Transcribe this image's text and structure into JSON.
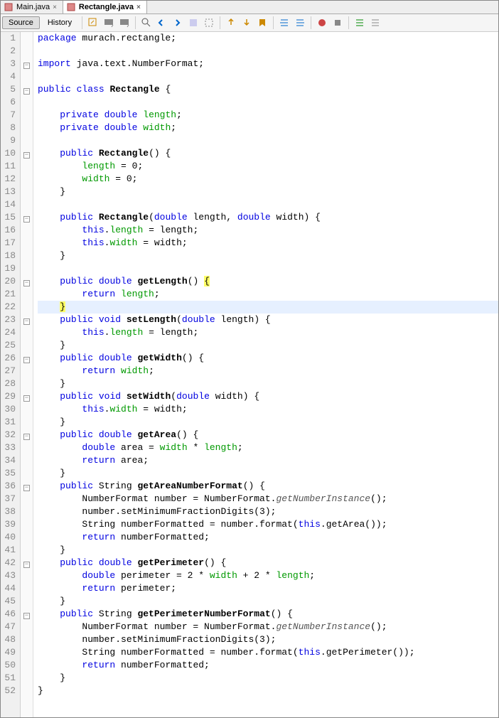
{
  "tabs": [
    {
      "label": "Main.java",
      "active": false
    },
    {
      "label": "Rectangle.java",
      "active": true
    }
  ],
  "viewButtons": {
    "source": "Source",
    "history": "History"
  },
  "gutter": [
    "1",
    "2",
    "3",
    "4",
    "5",
    "6",
    "7",
    "8",
    "9",
    "10",
    "11",
    "12",
    "13",
    "14",
    "15",
    "16",
    "17",
    "18",
    "19",
    "20",
    "21",
    "22",
    "23",
    "24",
    "25",
    "26",
    "27",
    "28",
    "29",
    "30",
    "31",
    "32",
    "33",
    "34",
    "35",
    "36",
    "37",
    "38",
    "39",
    "40",
    "41",
    "42",
    "43",
    "44",
    "45",
    "46",
    "47",
    "48",
    "49",
    "50",
    "51",
    "52"
  ],
  "code": {
    "l1": {
      "w1": "package",
      "w2": " murach.rectangle;"
    },
    "l3": {
      "w1": "import",
      "w2": " java.text.NumberFormat;"
    },
    "l5": {
      "w1": "public",
      "w2": "class",
      "w3": "Rectangle",
      "w4": " {"
    },
    "l7": {
      "w1": "private",
      "w2": "double",
      "w3": "length",
      "w4": ";"
    },
    "l8": {
      "w1": "private",
      "w2": "double",
      "w3": "width",
      "w4": ";"
    },
    "l10": {
      "w1": "public",
      "w2": "Rectangle",
      "w3": "() {"
    },
    "l11": {
      "w1": "length",
      "w2": " = 0;"
    },
    "l12": {
      "w1": "width",
      "w2": " = 0;"
    },
    "l13": "    }",
    "l15": {
      "w1": "public",
      "w2": "Rectangle",
      "w3": "(",
      "w4": "double",
      "w5": " length, ",
      "w6": "double",
      "w7": " width) {"
    },
    "l16": {
      "w1": "this",
      "w2": ".",
      "w3": "length",
      "w4": " = length;"
    },
    "l17": {
      "w1": "this",
      "w2": ".",
      "w3": "width",
      "w4": " = width;"
    },
    "l18": "    }",
    "l20": {
      "w1": "public",
      "w2": "double",
      "w3": "getLength",
      "w4": "() ",
      "w5": "{"
    },
    "l21": {
      "w1": "return",
      "w2": "length",
      "w3": ";"
    },
    "l22": "}",
    "l23": {
      "w1": "public",
      "w2": "void",
      "w3": "setLength",
      "w4": "(",
      "w5": "double",
      "w6": " length) {"
    },
    "l24": {
      "w1": "this",
      "w2": ".",
      "w3": "length",
      "w4": " = length;"
    },
    "l25": "    }",
    "l26": {
      "w1": "public",
      "w2": "double",
      "w3": "getWidth",
      "w4": "() {"
    },
    "l27": {
      "w1": "return",
      "w2": "width",
      "w3": ";"
    },
    "l28": "    }",
    "l29": {
      "w1": "public",
      "w2": "void",
      "w3": "setWidth",
      "w4": "(",
      "w5": "double",
      "w6": " width) {"
    },
    "l30": {
      "w1": "this",
      "w2": ".",
      "w3": "width",
      "w4": " = width;"
    },
    "l31": "    }",
    "l32": {
      "w1": "public",
      "w2": "double",
      "w3": "getArea",
      "w4": "() {"
    },
    "l33": {
      "w1": "double",
      "w2": " area = ",
      "w3": "width",
      "w4": " * ",
      "w5": "length",
      "w6": ";"
    },
    "l34": {
      "w1": "return",
      "w2": " area;"
    },
    "l35": "    }",
    "l36": {
      "w1": "public",
      "w2": " String ",
      "w3": "getAreaNumberFormat",
      "w4": "() {"
    },
    "l37": {
      "w1": "        NumberFormat number = NumberFormat.",
      "w2": "getNumberInstance",
      "w3": "();"
    },
    "l38": "        number.setMinimumFractionDigits(3);",
    "l39": {
      "w1": "        String numberFormatted = number.format(",
      "w2": "this",
      "w3": ".getArea());"
    },
    "l40": {
      "w1": "return",
      "w2": " numberFormatted;"
    },
    "l41": "    }",
    "l42": {
      "w1": "public",
      "w2": "double",
      "w3": "getPerimeter",
      "w4": "() {"
    },
    "l43": {
      "w1": "double",
      "w2": " perimeter = 2 * ",
      "w3": "width",
      "w4": " + 2 * ",
      "w5": "length",
      "w6": ";"
    },
    "l44": {
      "w1": "return",
      "w2": " perimeter;"
    },
    "l45": "    }",
    "l46": {
      "w1": "public",
      "w2": " String ",
      "w3": "getPerimeterNumberFormat",
      "w4": "() {"
    },
    "l47": {
      "w1": "        NumberFormat number = NumberFormat.",
      "w2": "getNumberInstance",
      "w3": "();"
    },
    "l48": "        number.setMinimumFractionDigits(3);",
    "l49": {
      "w1": "        String numberFormatted = number.format(",
      "w2": "this",
      "w3": ".getPerimeter());"
    },
    "l50": {
      "w1": "return",
      "w2": " numberFormatted;"
    },
    "l51": "    }",
    "l52": "}"
  }
}
